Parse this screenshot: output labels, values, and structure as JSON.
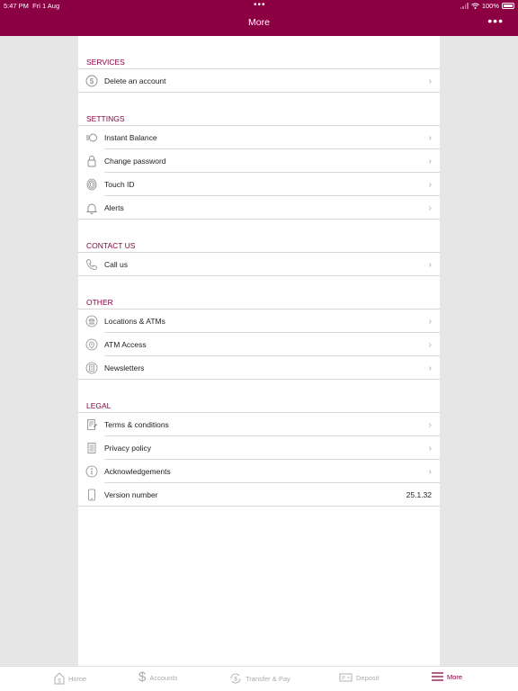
{
  "status_bar": {
    "time": "5:47 PM",
    "date": "Fri 1 Aug",
    "dots": "•••",
    "battery": "100%"
  },
  "nav": {
    "title": "More",
    "more": "•••"
  },
  "sections": {
    "services": {
      "title": "SERVICES",
      "items": [
        {
          "label": "Delete an account",
          "icon": "dollar-circle-icon"
        }
      ]
    },
    "settings": {
      "title": "SETTINGS",
      "items": [
        {
          "label": "Instant Balance",
          "icon": "instant-balance-icon"
        },
        {
          "label": "Change password",
          "icon": "lock-icon"
        },
        {
          "label": "Touch ID",
          "icon": "fingerprint-icon"
        },
        {
          "label": "Alerts",
          "icon": "bell-icon"
        }
      ]
    },
    "contact": {
      "title": "CONTACT US",
      "items": [
        {
          "label": "Call us",
          "icon": "phone-icon"
        }
      ]
    },
    "other": {
      "title": "OTHER",
      "items": [
        {
          "label": "Locations & ATMs",
          "icon": "bank-icon"
        },
        {
          "label": "ATM Access",
          "icon": "location-pin-icon"
        },
        {
          "label": "Newsletters",
          "icon": "newsletter-icon"
        }
      ]
    },
    "legal": {
      "title": "LEGAL",
      "items": [
        {
          "label": "Terms & conditions",
          "icon": "document-pen-icon"
        },
        {
          "label": "Privacy policy",
          "icon": "document-icon"
        },
        {
          "label": "Acknowledgements",
          "icon": "info-icon"
        },
        {
          "label": "Version number",
          "icon": "phone-device-icon",
          "value": "25.1.32"
        }
      ]
    }
  },
  "tabbar": {
    "home": "Home",
    "accounts": "Accounts",
    "transfer": "Transfer & Pay",
    "deposit": "Deposit",
    "more": "More"
  },
  "colors": {
    "brand": "#8a0042",
    "background": "#e6e6e6",
    "inactive_tab": "#aaaaaa"
  }
}
